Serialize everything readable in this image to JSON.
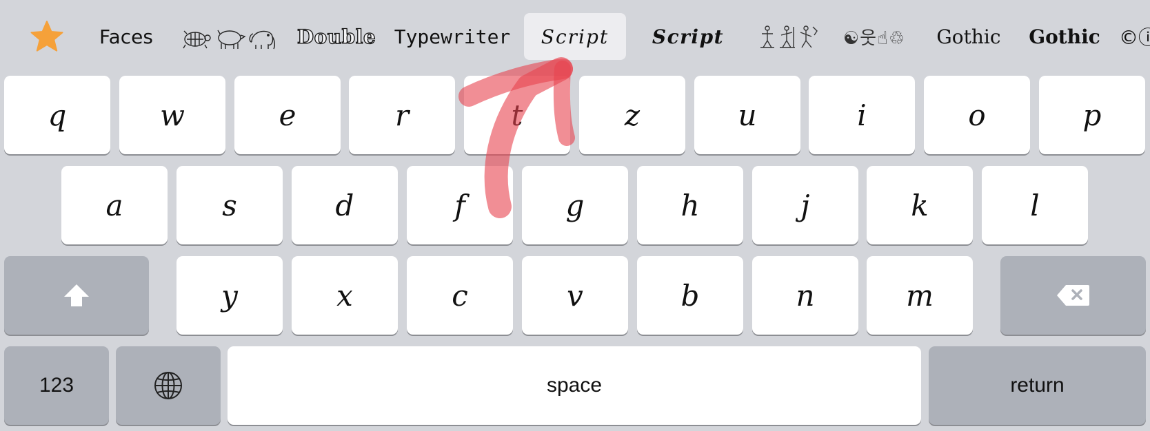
{
  "fontbar": {
    "items": [
      {
        "id": "favorites",
        "icon": "star-icon",
        "label": ""
      },
      {
        "id": "faces",
        "label": "Faces"
      },
      {
        "id": "animals",
        "label": "",
        "icon": "animal-glyphs-icon"
      },
      {
        "id": "double",
        "label": "Double"
      },
      {
        "id": "typewriter",
        "label": "Typewriter"
      },
      {
        "id": "script",
        "label": "Script",
        "selected": true
      },
      {
        "id": "script-bold",
        "label": "Script"
      },
      {
        "id": "hieroglyphs",
        "label": "",
        "icon": "hieroglyph-glyphs-icon"
      },
      {
        "id": "symbols",
        "label": "☯웃☝♲",
        "icon": "symbol-glyphs-icon"
      },
      {
        "id": "gothic",
        "label": "Gothic"
      },
      {
        "id": "gothic-bold",
        "label": "Gothic"
      },
      {
        "id": "circled",
        "label": "©ⓘ"
      }
    ],
    "accent_color": "#f5a13a",
    "selected_bg": "#ededf0"
  },
  "keyboard": {
    "row1": [
      "q",
      "w",
      "e",
      "r",
      "t",
      "z",
      "u",
      "i",
      "o",
      "p"
    ],
    "row2": [
      "a",
      "s",
      "d",
      "f",
      "g",
      "h",
      "j",
      "k",
      "l"
    ],
    "row3": [
      "y",
      "x",
      "c",
      "v",
      "b",
      "n",
      "m"
    ],
    "shift_icon": "shift-arrow-icon",
    "delete_icon": "backspace-icon",
    "numbers_label": "123",
    "globe_icon": "globe-icon",
    "space_label": "space",
    "return_label": "return"
  },
  "annotation": {
    "type": "hand-drawn-arrow",
    "color": "#e8434f",
    "points_to": "script"
  }
}
